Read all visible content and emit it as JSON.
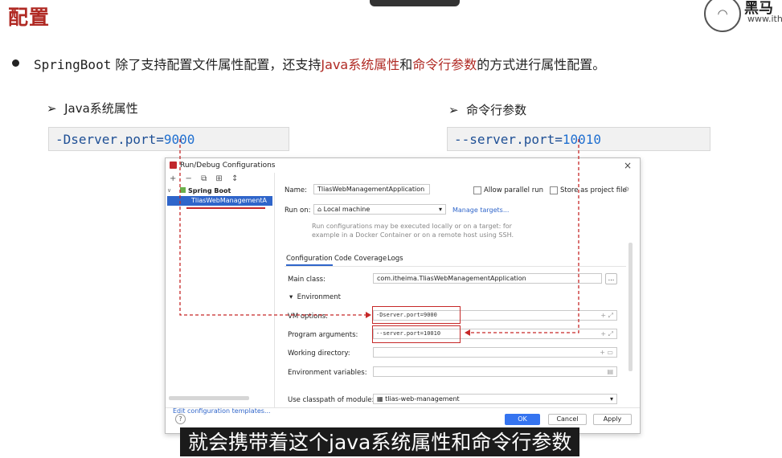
{
  "header": {
    "title": "配置",
    "logo_text": "黑马",
    "logo_url": "www.ith"
  },
  "bullet": {
    "prefix": "SpringBoot",
    "part1": " 除了支持配置文件属性配置，还支持",
    "hl1": "Java系统属性",
    "mid": "和",
    "hl2": "命令行参数",
    "part2": "的方式进行属性配置。"
  },
  "left_section": {
    "label": "Java系统属性",
    "code_key": "-Dserver.port=",
    "code_val": "9000"
  },
  "right_section": {
    "label": "命令行参数",
    "code_key": "--server.port=",
    "code_val": "10010"
  },
  "dialog": {
    "title": "Run/Debug Configurations",
    "close": "×",
    "tree": {
      "tools": "+ − ⧉ ⊞ ↕",
      "group": "Spring Boot",
      "selected": "TliasWebManagementA",
      "edit_templates": "Edit configuration templates..."
    },
    "name_label": "Name:",
    "name_value": "TliasWebManagementApplication",
    "allow_parallel": "Allow parallel run",
    "store_project": "Store as project file",
    "run_on_label": "Run on:",
    "run_on_value": "Local machine",
    "manage_targets": "Manage targets...",
    "run_hint1": "Run configurations may be executed locally or on a target: for",
    "run_hint2": "example in a Docker Container or on a remote host using SSH.",
    "tabs": [
      "Configuration",
      "Code Coverage",
      "Logs"
    ],
    "main_class_label": "Main class:",
    "main_class_value": "com.itheima.TliasWebManagementApplication",
    "browse": "...",
    "environment": "Environment",
    "vm_label": "VM options:",
    "vm_value": "-Dserver.port=9000",
    "prog_label": "Program arguments:",
    "prog_value": "--server.port=10010",
    "workdir_label": "Working directory:",
    "envvars_label": "Environment variables:",
    "classpath_label": "Use classpath of module:",
    "classpath_value": "tlias-web-management",
    "ok": "OK",
    "cancel": "Cancel",
    "apply": "Apply",
    "help": "?"
  },
  "caption": "就会携带着这个java系统属性和命令行参数",
  "colors": {
    "accent_red": "#b02a24",
    "link_blue": "#2f65ca",
    "ok_blue": "#3574f0"
  }
}
